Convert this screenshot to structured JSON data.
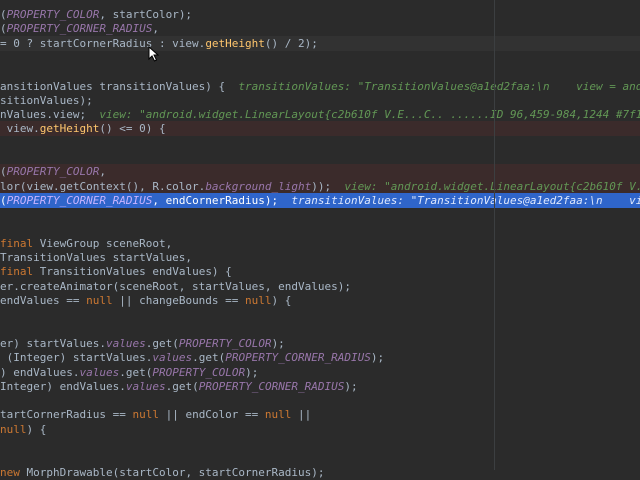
{
  "lines": [
    {
      "idx": 0,
      "bp": false,
      "sel": false,
      "caret": false,
      "segs": [
        {
          "t": "(",
          "c": "p"
        },
        {
          "t": "PROPERTY_COLOR",
          "c": "f"
        },
        {
          "t": ", startColor);",
          "c": "p"
        }
      ]
    },
    {
      "idx": 1,
      "bp": false,
      "sel": false,
      "caret": false,
      "segs": [
        {
          "t": "(",
          "c": "p"
        },
        {
          "t": "PROPERTY_CORNER_RADIUS",
          "c": "f"
        },
        {
          "t": ",",
          "c": "p"
        }
      ]
    },
    {
      "idx": 2,
      "bp": false,
      "sel": false,
      "caret": true,
      "segs": [
        {
          "t": "= 0 ? startCornerRadius : view.",
          "c": "p"
        },
        {
          "t": "getHeight",
          "c": "m"
        },
        {
          "t": "() / 2);",
          "c": "p"
        }
      ]
    },
    {
      "idx": 3,
      "bp": false,
      "sel": false,
      "caret": false,
      "segs": []
    },
    {
      "idx": 4,
      "bp": false,
      "sel": false,
      "caret": false,
      "segs": []
    },
    {
      "idx": 5,
      "bp": false,
      "sel": false,
      "caret": false,
      "segs": [
        {
          "t": "ansitionValues transitionValues) {  ",
          "c": "p"
        },
        {
          "t": "transitionValues: \"TransitionValues@a1ed2faa:\\n    view = android.widget.LinearLayout",
          "c": "hint"
        }
      ]
    },
    {
      "idx": 6,
      "bp": false,
      "sel": false,
      "caret": false,
      "segs": [
        {
          "t": "sitionValues);",
          "c": "p"
        }
      ]
    },
    {
      "idx": 7,
      "bp": false,
      "sel": false,
      "caret": false,
      "segs": [
        {
          "t": "nValues.view;  ",
          "c": "p"
        },
        {
          "t": "view: \"android.widget.LinearLayout{c2b610f V.E...C.. ......ID 96,459-984,1244 #7f110071 app:id/",
          "c": "hint"
        }
      ]
    },
    {
      "idx": 8,
      "bp": true,
      "sel": false,
      "caret": false,
      "segs": [
        {
          "t": " view.",
          "c": "p"
        },
        {
          "t": "getHeight",
          "c": "m"
        },
        {
          "t": "() <= 0) {",
          "c": "p"
        }
      ]
    },
    {
      "idx": 9,
      "bp": false,
      "sel": false,
      "caret": false,
      "segs": []
    },
    {
      "idx": 10,
      "bp": false,
      "sel": false,
      "caret": false,
      "segs": []
    },
    {
      "idx": 11,
      "bp": true,
      "sel": false,
      "caret": false,
      "segs": [
        {
          "t": "(",
          "c": "p"
        },
        {
          "t": "PROPERTY_COLOR",
          "c": "f"
        },
        {
          "t": ",",
          "c": "p"
        }
      ]
    },
    {
      "idx": 12,
      "bp": true,
      "sel": false,
      "caret": false,
      "segs": [
        {
          "t": "lor(view.getContext(), R.color.",
          "c": "p"
        },
        {
          "t": "background_light",
          "c": "f"
        },
        {
          "t": "));  ",
          "c": "p"
        },
        {
          "t": "view: \"android.widget.LinearLayout{c2b610f V.E...C.. ......",
          "c": "hint"
        }
      ]
    },
    {
      "idx": 13,
      "bp": false,
      "sel": true,
      "caret": false,
      "segs": [
        {
          "t": "(",
          "c": "p"
        },
        {
          "t": "PROPERTY_CORNER_RADIUS",
          "c": "f"
        },
        {
          "t": ", endCornerRadius);  ",
          "c": "p"
        },
        {
          "t": "transitionValues: \"TransitionValues@a1ed2faa:\\n    view = android.w",
          "c": "hint"
        }
      ]
    },
    {
      "idx": 14,
      "bp": false,
      "sel": false,
      "caret": false,
      "segs": []
    },
    {
      "idx": 15,
      "bp": false,
      "sel": false,
      "caret": false,
      "segs": []
    },
    {
      "idx": 16,
      "bp": false,
      "sel": false,
      "caret": false,
      "segs": [
        {
          "t": "final ",
          "c": "k"
        },
        {
          "t": "ViewGroup sceneRoot,",
          "c": "p"
        }
      ]
    },
    {
      "idx": 17,
      "bp": false,
      "sel": false,
      "caret": false,
      "segs": [
        {
          "t": "TransitionValues startValues,",
          "c": "p"
        }
      ]
    },
    {
      "idx": 18,
      "bp": false,
      "sel": false,
      "caret": false,
      "segs": [
        {
          "t": "final ",
          "c": "k"
        },
        {
          "t": "TransitionValues endValues) {",
          "c": "p"
        }
      ]
    },
    {
      "idx": 19,
      "bp": false,
      "sel": false,
      "caret": false,
      "segs": [
        {
          "t": "er.createAnimator(sceneRoot, startValues, endValues);",
          "c": "p"
        }
      ]
    },
    {
      "idx": 20,
      "bp": false,
      "sel": false,
      "caret": false,
      "segs": [
        {
          "t": "endValues == ",
          "c": "p"
        },
        {
          "t": "null",
          "c": "k"
        },
        {
          "t": " || changeBounds == ",
          "c": "p"
        },
        {
          "t": "null",
          "c": "k"
        },
        {
          "t": ") {",
          "c": "p"
        }
      ]
    },
    {
      "idx": 21,
      "bp": false,
      "sel": false,
      "caret": false,
      "segs": []
    },
    {
      "idx": 22,
      "bp": false,
      "sel": false,
      "caret": false,
      "segs": []
    },
    {
      "idx": 23,
      "bp": false,
      "sel": false,
      "caret": false,
      "segs": [
        {
          "t": "er) startValues.",
          "c": "p"
        },
        {
          "t": "values",
          "c": "f"
        },
        {
          "t": ".get(",
          "c": "p"
        },
        {
          "t": "PROPERTY_COLOR",
          "c": "f"
        },
        {
          "t": ");",
          "c": "p"
        }
      ]
    },
    {
      "idx": 24,
      "bp": false,
      "sel": false,
      "caret": false,
      "segs": [
        {
          "t": " (Integer) startValues.",
          "c": "p"
        },
        {
          "t": "values",
          "c": "f"
        },
        {
          "t": ".get(",
          "c": "p"
        },
        {
          "t": "PROPERTY_CORNER_RADIUS",
          "c": "f"
        },
        {
          "t": ");",
          "c": "p"
        }
      ]
    },
    {
      "idx": 25,
      "bp": false,
      "sel": false,
      "caret": false,
      "segs": [
        {
          "t": ") endValues.",
          "c": "p"
        },
        {
          "t": "values",
          "c": "f"
        },
        {
          "t": ".get(",
          "c": "p"
        },
        {
          "t": "PROPERTY_COLOR",
          "c": "f"
        },
        {
          "t": ");",
          "c": "p"
        }
      ]
    },
    {
      "idx": 26,
      "bp": false,
      "sel": false,
      "caret": false,
      "segs": [
        {
          "t": "Integer) endValues.",
          "c": "p"
        },
        {
          "t": "values",
          "c": "f"
        },
        {
          "t": ".get(",
          "c": "p"
        },
        {
          "t": "PROPERTY_CORNER_RADIUS",
          "c": "f"
        },
        {
          "t": ");",
          "c": "p"
        }
      ]
    },
    {
      "idx": 27,
      "bp": false,
      "sel": false,
      "caret": false,
      "segs": []
    },
    {
      "idx": 28,
      "bp": false,
      "sel": false,
      "caret": false,
      "segs": [
        {
          "t": "tartCornerRadius == ",
          "c": "p"
        },
        {
          "t": "null",
          "c": "k"
        },
        {
          "t": " || endColor == ",
          "c": "p"
        },
        {
          "t": "null",
          "c": "k"
        },
        {
          "t": " ||",
          "c": "p"
        }
      ]
    },
    {
      "idx": 29,
      "bp": false,
      "sel": false,
      "caret": false,
      "segs": [
        {
          "t": "null",
          "c": "k"
        },
        {
          "t": ") {",
          "c": "p"
        }
      ]
    },
    {
      "idx": 30,
      "bp": false,
      "sel": false,
      "caret": false,
      "segs": []
    },
    {
      "idx": 31,
      "bp": false,
      "sel": false,
      "caret": false,
      "segs": []
    },
    {
      "idx": 32,
      "bp": false,
      "sel": false,
      "caret": false,
      "segs": [
        {
          "t": "new ",
          "c": "k"
        },
        {
          "t": "MorphDrawable(startColor, startCornerRadius);",
          "c": "p"
        }
      ]
    }
  ],
  "colors": {
    "background": "#2b2b2b",
    "plain": "#a9b7c6",
    "field": "#9876aa",
    "keyword": "#cc7832",
    "method": "#ffc66d",
    "inline_hint": "#629755",
    "selection": "#2f65ca",
    "breakpoint_line": "#3b2b2b"
  },
  "icons": {
    "mouse_cursor": "arrow-cursor-icon"
  }
}
